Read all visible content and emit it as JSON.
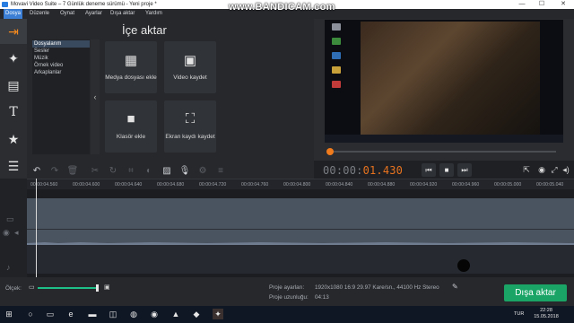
{
  "window": {
    "title": "Movavi Video Suite – 7 Günlük deneme sürümü - Yeni proje *",
    "watermark": "www.BANDICAM.com",
    "controls": {
      "minimize": "—",
      "maximize": "☐",
      "close": "✕"
    }
  },
  "menu": {
    "items": [
      "Dosya",
      "Düzenle",
      "Oynat",
      "Ayarlar",
      "Dışa aktar",
      "Yardım"
    ],
    "active": "Dosya"
  },
  "rail": {
    "tools": [
      {
        "name": "import-tool",
        "icon": "film-import-icon",
        "glyph": "⇥"
      },
      {
        "name": "filters-tool",
        "icon": "magic-wand-icon",
        "glyph": "✦"
      },
      {
        "name": "transitions-tool",
        "icon": "film-strip-icon",
        "glyph": "▤"
      },
      {
        "name": "titles-tool",
        "icon": "text-icon",
        "glyph": "T"
      },
      {
        "name": "stickers-tool",
        "icon": "star-badge-icon",
        "glyph": "★"
      },
      {
        "name": "more-tool",
        "icon": "menu-lines-icon",
        "glyph": "☰"
      }
    ]
  },
  "import": {
    "title": "İçe aktar",
    "categories": [
      "Dosyalarım",
      "Sesler",
      "Müzik",
      "Örnek video",
      "Arkaplanlar"
    ],
    "selected_category": "Dosyalarım",
    "collapse_glyph": "‹",
    "tiles": [
      {
        "label": "Medya dosyası ekle",
        "icon": "media-file-icon",
        "glyph": "▦"
      },
      {
        "label": "Video kaydet",
        "icon": "camera-icon",
        "glyph": "▣"
      },
      {
        "label": "Klasör ekle",
        "icon": "folder-icon",
        "glyph": "■"
      },
      {
        "label": "Ekran kaydı kaydet",
        "icon": "screen-capture-icon",
        "glyph": "⛶"
      }
    ]
  },
  "edit_toolbar": {
    "buttons": [
      {
        "name": "undo-button",
        "glyph": "↶",
        "enabled": true
      },
      {
        "name": "redo-button",
        "glyph": "↷",
        "enabled": false
      },
      {
        "name": "delete-button",
        "glyph": "🗑",
        "enabled": false
      },
      {
        "name": "cut-button",
        "glyph": "✂",
        "enabled": false
      },
      {
        "name": "rotate-button",
        "glyph": "↻",
        "enabled": false
      },
      {
        "name": "crop-button",
        "glyph": "⌗",
        "enabled": false
      },
      {
        "name": "color-adjust-button",
        "glyph": "◐",
        "enabled": false
      },
      {
        "name": "image-button",
        "glyph": "▨",
        "enabled": true
      },
      {
        "name": "microphone-button",
        "glyph": "🎙",
        "enabled": true
      },
      {
        "name": "settings-button",
        "glyph": "⚙",
        "enabled": false
      },
      {
        "name": "audio-levels-button",
        "glyph": "≡",
        "enabled": false
      }
    ]
  },
  "player": {
    "timecode_prefix": "00:00:",
    "timecode_current": "01.430",
    "transport": [
      {
        "name": "previous-frame-button",
        "glyph": "⏮"
      },
      {
        "name": "stop-button",
        "glyph": "■"
      },
      {
        "name": "next-frame-button",
        "glyph": "⏭"
      }
    ],
    "right_controls": [
      {
        "name": "export-frame-button",
        "glyph": "⇱"
      },
      {
        "name": "snapshot-button",
        "glyph": "◉"
      },
      {
        "name": "fullscreen-button",
        "glyph": "⤢"
      },
      {
        "name": "volume-button",
        "glyph": "◂)"
      }
    ]
  },
  "ruler": {
    "ticks": [
      "00:00:04.560",
      "00:00:04.600",
      "00:00:04.640",
      "00:00:04.680",
      "00:00:04.720",
      "00:00:04.760",
      "00:00:04.800",
      "00:00:04.840",
      "00:00:04.880",
      "00:00:04.920",
      "00:00:04.960",
      "00:00:05.000",
      "00:00:05.040"
    ]
  },
  "status": {
    "scale_label": "Ölçek:",
    "project_settings_label": "Proje ayarları:",
    "project_settings_value": "1920x1080 16:9 29.97 Kare/sn., 44100 Hz Stereo",
    "project_length_label": "Proje uzunluğu:",
    "project_length_value": "04:13",
    "export_button": "Dışa aktar",
    "zoom_level": 0.97
  },
  "taskbar": {
    "lang": "TUR",
    "time": "22:28",
    "date": "15.05.2018"
  },
  "colors": {
    "accent_orange": "#f07b1c",
    "export_green": "#1aa566",
    "menu_active": "#3a7fd5"
  }
}
